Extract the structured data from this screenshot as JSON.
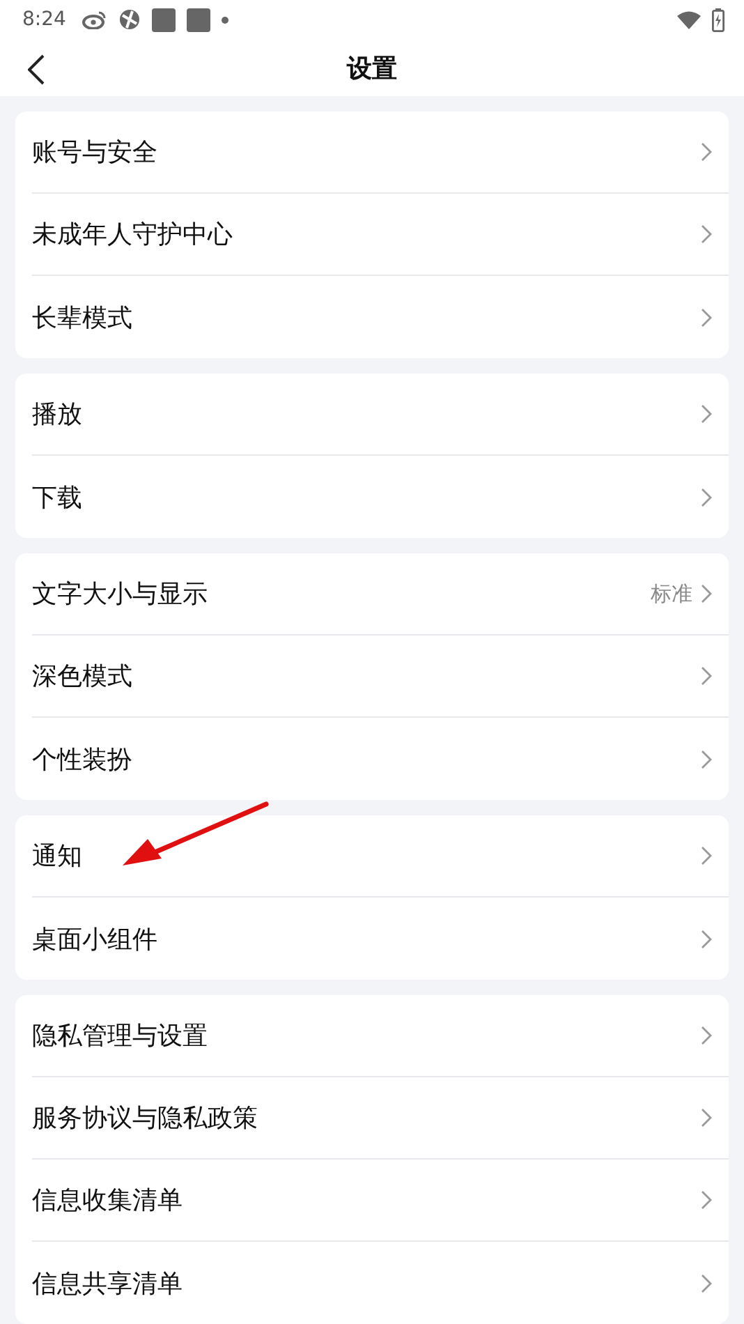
{
  "status_bar": {
    "time": "8:24"
  },
  "header": {
    "title": "设置"
  },
  "groups": [
    {
      "items": [
        {
          "label": "账号与安全"
        },
        {
          "label": "未成年人守护中心"
        },
        {
          "label": "长辈模式"
        }
      ]
    },
    {
      "items": [
        {
          "label": "播放"
        },
        {
          "label": "下载"
        }
      ]
    },
    {
      "items": [
        {
          "label": "文字大小与显示",
          "value": "标准"
        },
        {
          "label": "深色模式"
        },
        {
          "label": "个性装扮"
        }
      ]
    },
    {
      "items": [
        {
          "label": "通知"
        },
        {
          "label": "桌面小组件"
        }
      ]
    },
    {
      "items": [
        {
          "label": "隐私管理与设置"
        },
        {
          "label": "服务协议与隐私政策"
        },
        {
          "label": "信息收集清单"
        },
        {
          "label": "信息共享清单"
        }
      ]
    }
  ]
}
